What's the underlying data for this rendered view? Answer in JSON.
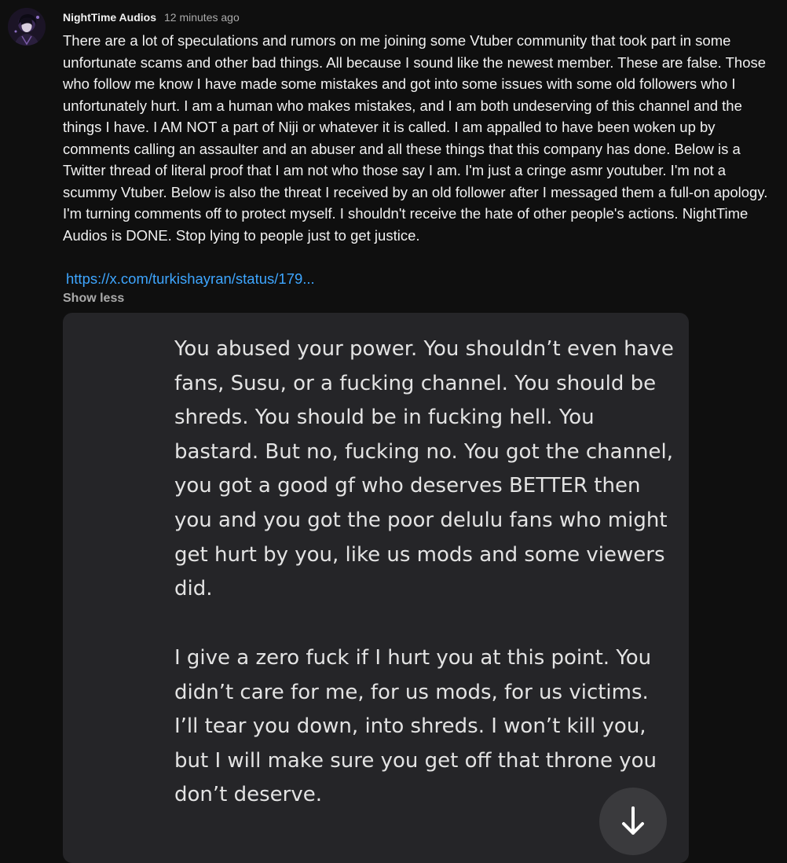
{
  "post": {
    "author": "NightTime Audios",
    "timestamp": "12 minutes ago",
    "text": "There are a lot of speculations and rumors on me joining some Vtuber community that took part in some unfortunate scams and other bad things. All because I sound like the newest member. These are false. Those who follow me know I have made some mistakes and got into some issues with some old followers who I unfortunately hurt. I am a human who makes mistakes, and I am both undeserving of this channel and the things I have. I AM NOT a part of Niji or whatever it is called. I am appalled to have been woken up by comments calling an assaulter and an abuser and all these things that this company has done. Below is a Twitter thread of literal proof that I am not who those say I am. I'm just a cringe asmr youtuber. I'm not a scummy Vtuber. Below is also the threat I received by an old follower after I messaged them a full-on apology. I'm turning comments off to protect myself. I shouldn't receive the hate of other people's actions. NightTime Audios is DONE. Stop lying to people just to get justice.",
    "link": "https://x.com/turkishayran/status/179...",
    "show_less_label": "Show less"
  },
  "attachment": {
    "paragraphs": [
      "You abused your power. You shouldn’t even have fans, Susu, or a fucking channel. You should be shreds. You should be in fucking hell. You bastard. But no, fucking no. You got the channel, you got a good gf who deserves BETTER then you and you got the poor delulu fans who might get hurt by you, like us mods and some viewers did.",
      "I give a zero fuck if I hurt you at this point. You didn’t care for me, for us mods, for us victims. I’ll tear you down, into shreds. I won’t kill you, but I will make sure you get off that throne you don’t deserve."
    ]
  },
  "icons": {
    "avatar": "avatar-image",
    "scroll": "arrow-down-icon"
  },
  "colors": {
    "background": "#0f0f0f",
    "text": "#f1f1f1",
    "secondary_text": "#aaaaaa",
    "link": "#3ea6ff",
    "attachment_background": "#252528"
  }
}
